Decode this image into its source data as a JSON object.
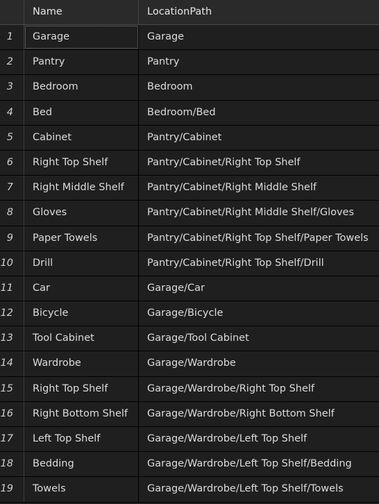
{
  "table": {
    "columns": {
      "index": "",
      "name": "Name",
      "path": "LocationPath"
    },
    "rows": [
      {
        "index": "1",
        "name": "Garage",
        "path": "Garage"
      },
      {
        "index": "2",
        "name": "Pantry",
        "path": "Pantry"
      },
      {
        "index": "3",
        "name": "Bedroom",
        "path": "Bedroom"
      },
      {
        "index": "4",
        "name": "Bed",
        "path": "Bedroom/Bed"
      },
      {
        "index": "5",
        "name": "Cabinet",
        "path": "Pantry/Cabinet"
      },
      {
        "index": "6",
        "name": "Right Top Shelf",
        "path": "Pantry/Cabinet/Right Top Shelf"
      },
      {
        "index": "7",
        "name": "Right Middle Shelf",
        "path": "Pantry/Cabinet/Right Middle Shelf"
      },
      {
        "index": "8",
        "name": "Gloves",
        "path": "Pantry/Cabinet/Right Middle Shelf/Gloves"
      },
      {
        "index": "9",
        "name": "Paper Towels",
        "path": "Pantry/Cabinet/Right Top Shelf/Paper Towels"
      },
      {
        "index": "10",
        "name": "Drill",
        "path": "Pantry/Cabinet/Right Top Shelf/Drill"
      },
      {
        "index": "11",
        "name": "Car",
        "path": "Garage/Car"
      },
      {
        "index": "12",
        "name": "Bicycle",
        "path": "Garage/Bicycle"
      },
      {
        "index": "13",
        "name": "Tool Cabinet",
        "path": "Garage/Tool Cabinet"
      },
      {
        "index": "14",
        "name": "Wardrobe",
        "path": "Garage/Wardrobe"
      },
      {
        "index": "15",
        "name": "Right Top Shelf",
        "path": "Garage/Wardrobe/Right Top Shelf"
      },
      {
        "index": "16",
        "name": "Right Bottom Shelf",
        "path": "Garage/Wardrobe/Right Bottom Shelf"
      },
      {
        "index": "17",
        "name": "Left Top Shelf",
        "path": "Garage/Wardrobe/Left Top Shelf"
      },
      {
        "index": "18",
        "name": "Bedding",
        "path": "Garage/Wardrobe/Left Top Shelf/Bedding"
      },
      {
        "index": "19",
        "name": "Towels",
        "path": "Garage/Wardrobe/Left Top Shelf/Towels"
      }
    ]
  }
}
